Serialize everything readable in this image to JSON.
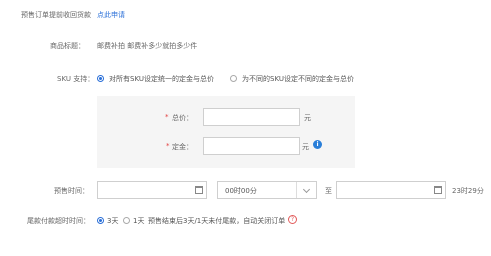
{
  "header": {
    "text": "预售订单提前收回货款",
    "link": "点此申请"
  },
  "product": {
    "label": "商品标题：",
    "value": "邮费补拍 邮费补多少就拍多少件"
  },
  "sku": {
    "label": "SKU 支持：",
    "options": [
      {
        "label": "对所有SKU设定统一的定金与总价",
        "selected": true
      },
      {
        "label": "为不同的SKU设定不同的定金与总价",
        "selected": false
      }
    ]
  },
  "price_panel": {
    "total": {
      "asterisk": "*",
      "label": "总价：",
      "value": "",
      "unit": "元"
    },
    "deposit": {
      "asterisk": "*",
      "label": "定金：",
      "value": "",
      "unit": "元",
      "icon": "info-icon"
    }
  },
  "presale_time": {
    "label": "预售时间：",
    "start_date": "",
    "start_time": "00时00分",
    "separator": "至",
    "end_date": "",
    "end_time": "23时29分",
    "icons": {
      "calendar": "calendar-icon",
      "dropdown": "chevron-down-icon"
    }
  },
  "balance_timeout": {
    "label": "尾款付款超时时间：",
    "options": [
      {
        "label": "3天",
        "selected": true
      },
      {
        "label": "1天",
        "selected": false
      }
    ],
    "note": "预售结束后3天/1天未付尾款，自动关闭订单",
    "help_icon": "help-icon"
  },
  "colors": {
    "link": "#2a6fd8",
    "required": "#e23b3b",
    "panel_bg": "#f5f5f5",
    "info": "#2a7fd9",
    "help": "#e25a5a"
  }
}
